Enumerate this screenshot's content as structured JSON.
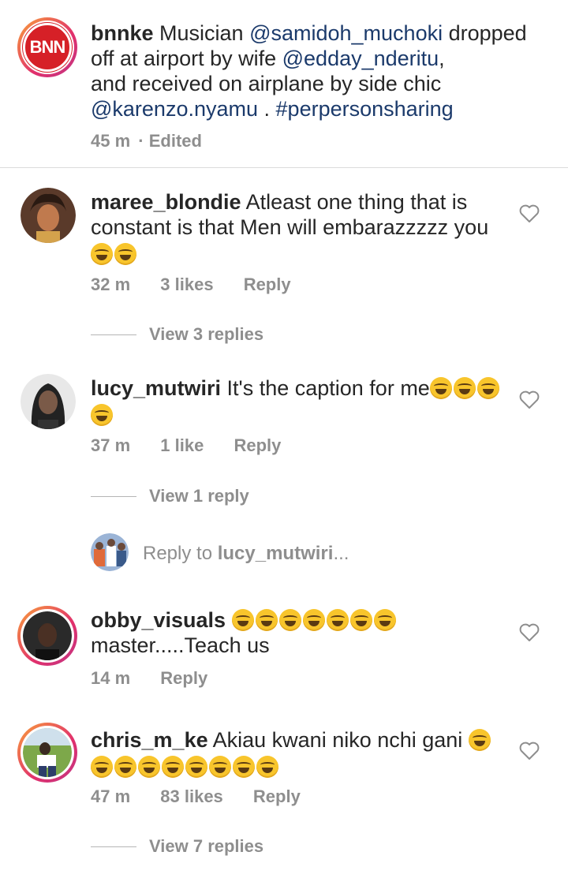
{
  "caption": {
    "avatar_logo": "BNN",
    "username": "bnnke",
    "segments": {
      "t1": " Musician ",
      "m1": "@samidoh_muchoki",
      "t2": " dropped",
      "t3": "off at airport by wife ",
      "m2": "@edday_nderitu",
      "t4": ",",
      "t5": "and received on airplane by side chic",
      "m3": "@karenzo.nyamu",
      "t6": " . ",
      "m4": "#perpersonsharing"
    },
    "time": "45 m",
    "edited": "· Edited"
  },
  "comments": [
    {
      "username": "maree_blondie",
      "line1": " Atleast one thing that is",
      "line2": "constant is that Men will embarazzzzz you",
      "time": "32 m",
      "likes": "3 likes",
      "reply": "Reply",
      "view_replies": "View 3 replies",
      "emoji_count": 2
    },
    {
      "username": "lucy_mutwiri",
      "line1": " It's the caption for me",
      "time": "37 m",
      "likes": "1 like",
      "reply": "Reply",
      "view_replies": "View 1 reply"
    },
    {
      "username": "obby_visuals",
      "line2": "master.....Teach us",
      "time": "14 m",
      "reply": "Reply"
    },
    {
      "username": "chris_m_ke",
      "line1": " Akiau kwani niko nchi gani",
      "time": "47 m",
      "likes": "83 likes",
      "reply": "Reply",
      "view_replies": "View 7 replies"
    }
  ],
  "reply_box": {
    "prefix": "Reply to ",
    "target": "lucy_mutwiri",
    "suffix": "..."
  },
  "icons": {
    "heart": "heart-outline-icon",
    "emoji": "face-with-tears-of-joy"
  },
  "colors": {
    "mention": "#1b3a6b",
    "meta": "#8e8e8e",
    "brand_red": "#d62027"
  }
}
